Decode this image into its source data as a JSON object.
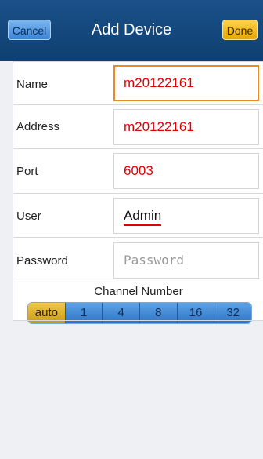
{
  "navbar": {
    "cancel_label": "Cancel",
    "title": "Add Device",
    "done_label": "Done"
  },
  "form": {
    "fields": [
      {
        "label": "Name",
        "value": "m20122161"
      },
      {
        "label": "Address",
        "value": "m20122161"
      },
      {
        "label": "Port",
        "value": "6003"
      },
      {
        "label": "User",
        "value": "Admin"
      },
      {
        "label": "Password",
        "placeholder": "Password"
      }
    ],
    "channel": {
      "title": "Channel Number",
      "options": [
        "auto",
        "1",
        "4",
        "8",
        "16",
        "32"
      ],
      "selected": "auto"
    }
  },
  "colors": {
    "nav_bg": "#1a5189",
    "focus_border": "#e98a24",
    "value_red": "#e00000",
    "segment_active": "#e0b22a",
    "segment_blue": "#3b84d8"
  }
}
